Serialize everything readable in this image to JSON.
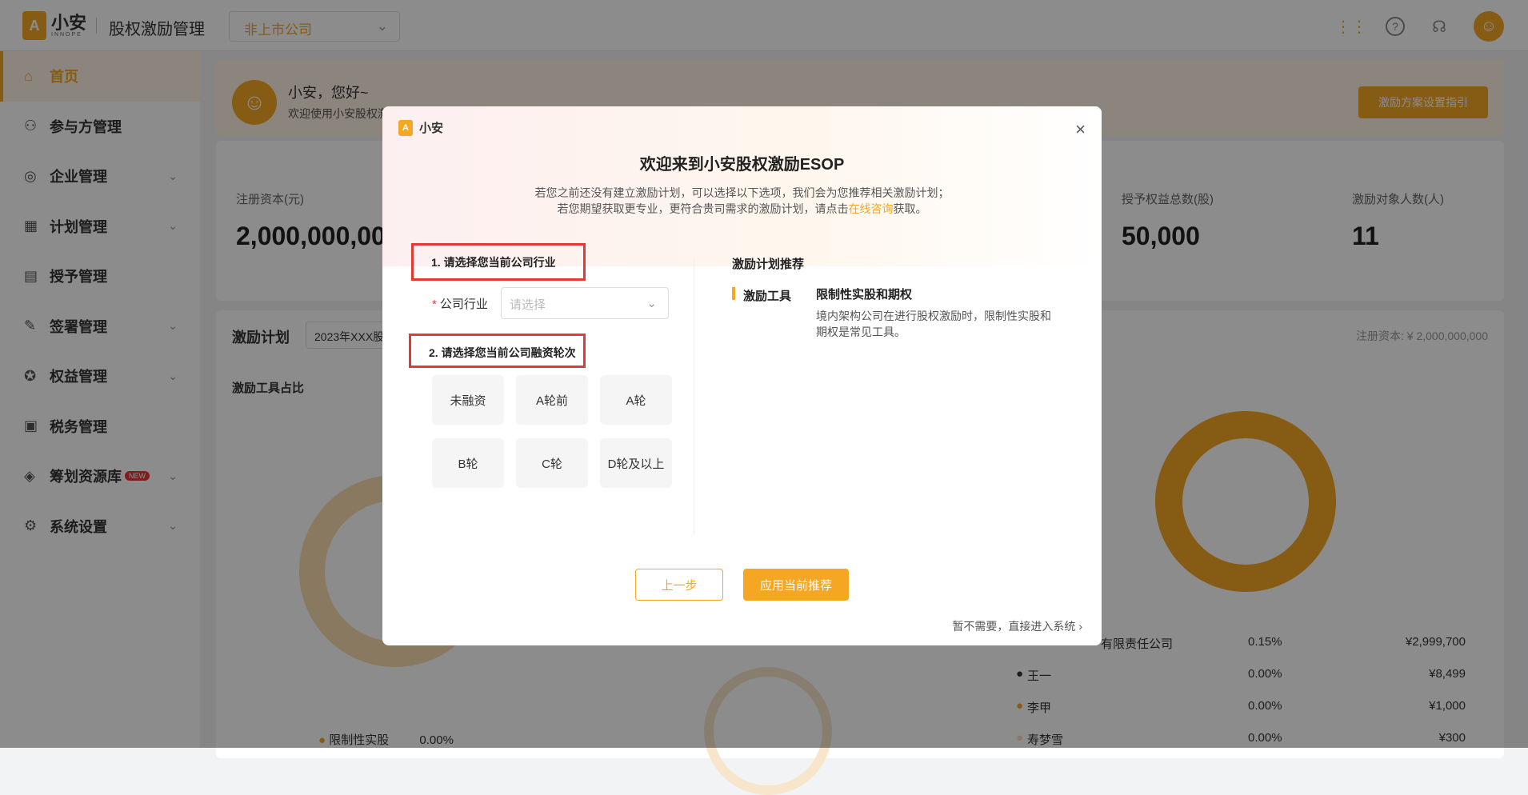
{
  "header": {
    "logo_text": "小安",
    "logo_sub": "INNOPE",
    "app_name": "股权激励管理",
    "company_select": "非上市公司"
  },
  "sidebar": {
    "items": [
      {
        "label": "首页",
        "icon": "home-icon"
      },
      {
        "label": "参与方管理",
        "icon": "users-icon"
      },
      {
        "label": "企业管理",
        "icon": "enterprise-icon"
      },
      {
        "label": "计划管理",
        "icon": "plan-icon"
      },
      {
        "label": "授予管理",
        "icon": "grant-icon"
      },
      {
        "label": "签署管理",
        "icon": "sign-icon"
      },
      {
        "label": "权益管理",
        "icon": "equity-icon"
      },
      {
        "label": "税务管理",
        "icon": "tax-icon"
      },
      {
        "label": "筹划资源库",
        "icon": "layers-icon",
        "badge": "NEW"
      },
      {
        "label": "系统设置",
        "icon": "settings-icon"
      }
    ]
  },
  "welcome": {
    "hello": "小安，您好~",
    "sub": "欢迎使用小安股权激励ESOP",
    "guide_button": "激励方案设置指引"
  },
  "stats": {
    "reg_capital_label": "注册资本(元)",
    "reg_capital_value": "2,000,000,000",
    "granted_label": "授予权益总数(股)",
    "granted_value": "50,000",
    "people_label": "激励对象人数(人)",
    "people_value": "11"
  },
  "plan": {
    "title": "激励计划",
    "select": "2023年XXX股",
    "reg_capital": "注册资本: ¥ 2,000,000,000",
    "ratio_title": "激励工具占比",
    "legend_left": {
      "name": "限制性实股",
      "pct": "0.00%"
    },
    "holders": [
      {
        "name": "有限责任公司",
        "pct": "0.15%",
        "amount": "¥2,999,700"
      },
      {
        "name": "王一",
        "pct": "0.00%",
        "amount": "¥8,499"
      },
      {
        "name": "李甲",
        "pct": "0.00%",
        "amount": "¥1,000"
      },
      {
        "name": "寿梦雪",
        "pct": "0.00%",
        "amount": "¥300"
      }
    ]
  },
  "modal": {
    "brand": "小安",
    "title": "欢迎来到小安股权激励ESOP",
    "desc_line1": "若您之前还没有建立激励计划，可以选择以下选项，我们会为您推荐相关激励计划；",
    "desc_line2_pre": "若您期望获取更专业，更符合贵司需求的激励计划，请点击",
    "desc_link": "在线咨询",
    "desc_line2_post": "获取。",
    "step1": "1. 请选择您当前公司行业",
    "industry_label": "公司行业",
    "industry_placeholder": "请选择",
    "step2": "2. 请选择您当前公司融资轮次",
    "rounds": [
      "未融资",
      "A轮前",
      "A轮",
      "B轮",
      "C轮",
      "D轮及以上"
    ],
    "rec_title": "激励计划推荐",
    "rec_tool_label": "激励工具",
    "rec_tool_value": "限制性实股和期权",
    "rec_tool_desc": "境内架构公司在进行股权激励时，限制性实股和期权是常见工具。",
    "prev_button": "上一步",
    "apply_button": "应用当前推荐",
    "skip": "暂不需要，直接进入系统"
  },
  "colors": {
    "accent": "#f5a623",
    "highlight": "#e53935"
  }
}
